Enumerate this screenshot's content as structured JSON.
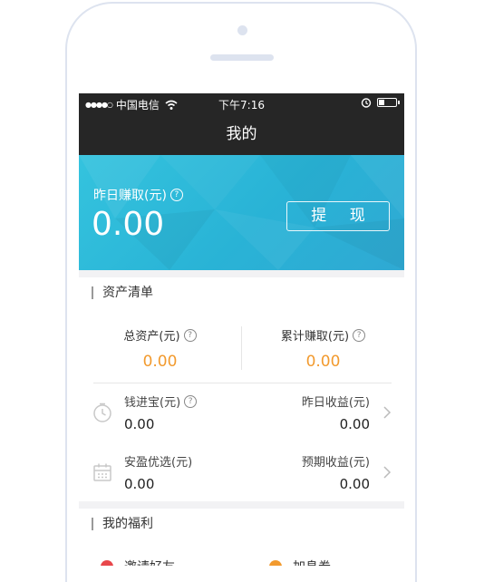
{
  "status_bar": {
    "signal_dots": "●●●●○",
    "carrier": "中国电信",
    "time": "下午7:16",
    "battery_level": 0.35,
    "icons": [
      "wifi-icon",
      "alarm-icon",
      "battery-icon"
    ]
  },
  "nav": {
    "title": "我的"
  },
  "earnings": {
    "label": "昨日赚取(元)",
    "amount": "0.00",
    "withdraw_label": "提 现",
    "banner_color": "#2fb7d9"
  },
  "assets": {
    "title": "资产清单",
    "total_assets_label": "总资产(元)",
    "total_assets_value": "0.00",
    "cumulative_label": "累计赚取(元)",
    "cumulative_value": "0.00",
    "accent_color": "#f29a2e",
    "products": [
      {
        "name": "钱进宝(元)",
        "value": "0.00",
        "right_label": "昨日收益(元)",
        "right_value": "0.00",
        "icon": "clock-icon"
      },
      {
        "name": "安盈优选(元)",
        "value": "0.00",
        "right_label": "预期收益(元)",
        "right_value": "0.00",
        "icon": "calendar-icon"
      }
    ]
  },
  "benefits": {
    "title": "我的福利",
    "items": [
      {
        "label": "邀请好友",
        "color": "#e8474b"
      },
      {
        "label": "加息券",
        "color": "#f29a2e"
      }
    ]
  }
}
